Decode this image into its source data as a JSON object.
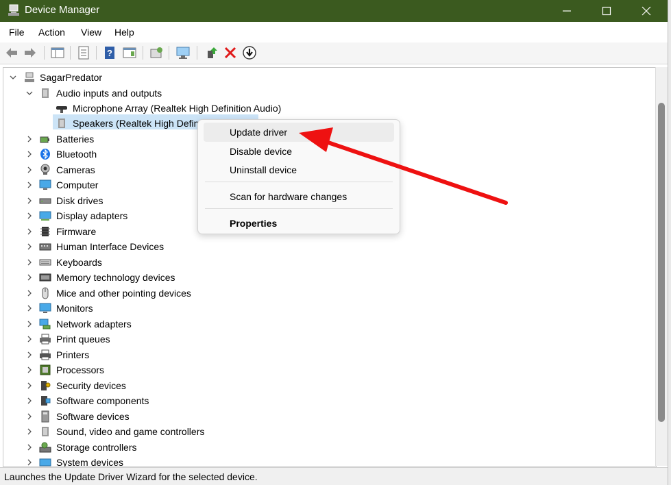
{
  "window": {
    "title": "Device Manager",
    "icon": "device-manager-icon",
    "controls": [
      "minimize-icon",
      "maximize-icon",
      "close-icon"
    ]
  },
  "menubar": {
    "items": [
      "File",
      "Action",
      "View",
      "Help"
    ]
  },
  "toolbar": {
    "icons": [
      "back-arrow-icon",
      "forward-arrow-icon",
      "show-hide-console-tree-icon",
      "properties-icon",
      "help-icon",
      "action-pane-icon",
      "update-driver-icon",
      "scan-hardware-icon",
      "add-driver-icon",
      "uninstall-x-icon",
      "download-icon"
    ]
  },
  "tree": {
    "root": "SagarPredator",
    "audio_category": "Audio inputs and outputs",
    "audio_children": [
      "Microphone Array (Realtek High Definition Audio)",
      "Speakers (Realtek High Defin"
    ],
    "categories": [
      "Batteries",
      "Bluetooth",
      "Cameras",
      "Computer",
      "Disk drives",
      "Display adapters",
      "Firmware",
      "Human Interface Devices",
      "Keyboards",
      "Memory technology devices",
      "Mice and other pointing devices",
      "Monitors",
      "Network adapters",
      "Print queues",
      "Printers",
      "Processors",
      "Security devices",
      "Software components",
      "Software devices",
      "Sound, video and game controllers",
      "Storage controllers",
      "System devices"
    ]
  },
  "context_menu": {
    "update_driver": "Update driver",
    "disable_device": "Disable device",
    "uninstall_device": "Uninstall device",
    "scan_hardware": "Scan for hardware changes",
    "properties": "Properties"
  },
  "statusbar": {
    "text": "Launches the Update Driver Wizard for the selected device."
  },
  "colors": {
    "titlebar": "#3b5a1f",
    "selection": "#cce4f7",
    "annotation_arrow": "#ee1111"
  }
}
